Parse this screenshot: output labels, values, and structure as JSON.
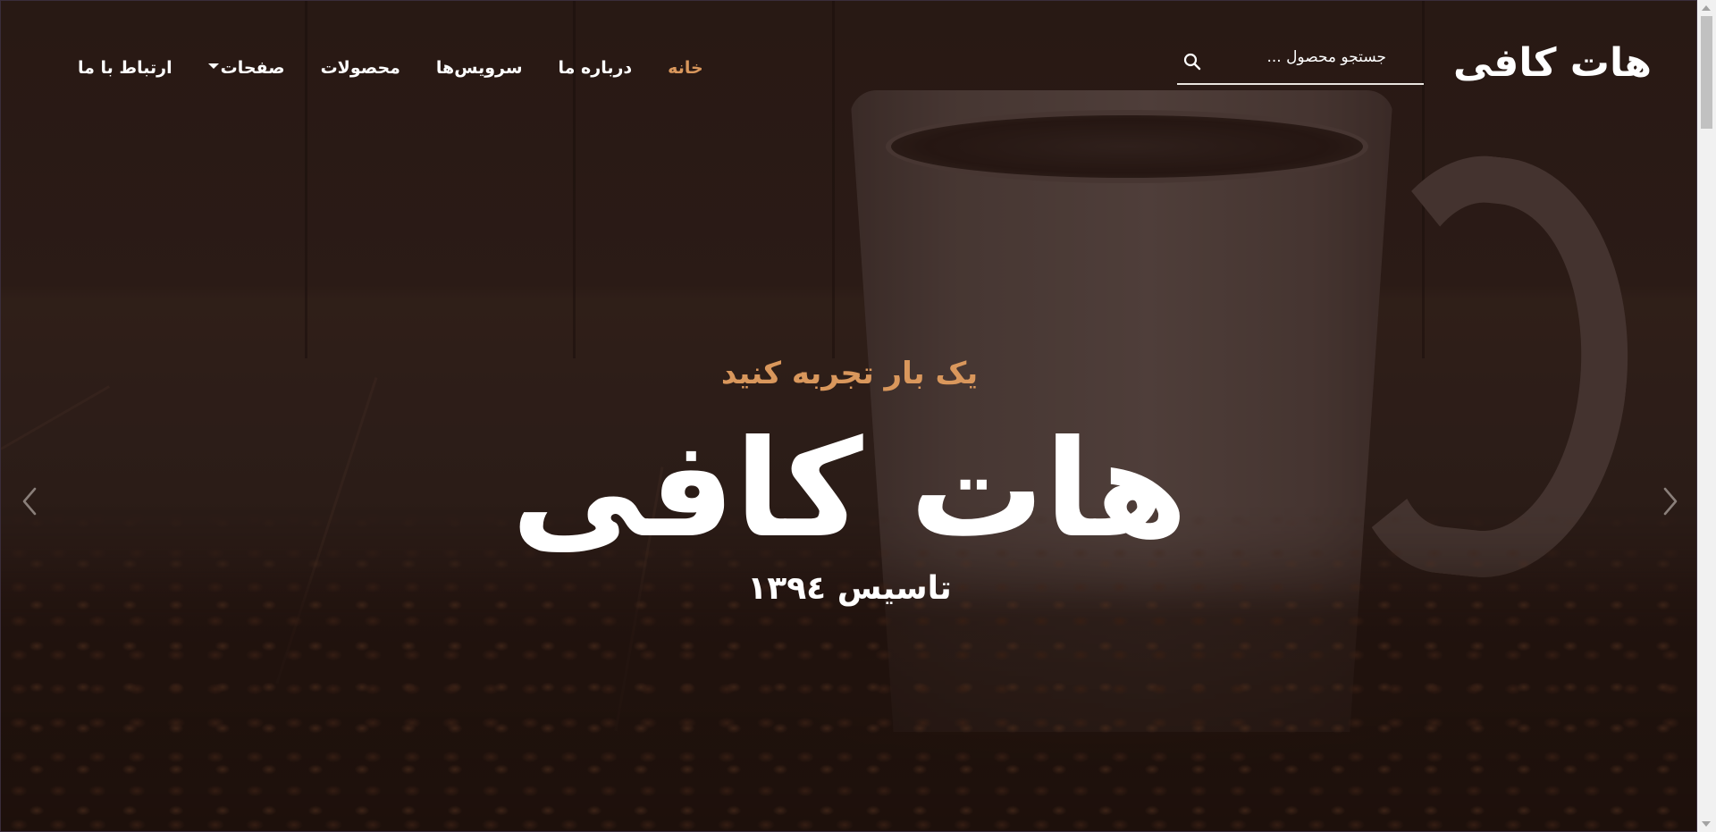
{
  "header": {
    "brand": "هات کافی",
    "search_placeholder": "جستجو محصول ...",
    "nav": [
      {
        "label": "خانه",
        "active": true
      },
      {
        "label": "درباره ما"
      },
      {
        "label": "سرویس‌ها"
      },
      {
        "label": "محصولات"
      },
      {
        "label": "صفحات",
        "has_dropdown": true
      },
      {
        "label": "ارتباط با ما"
      }
    ]
  },
  "hero": {
    "tagline": "یک بار تجربه کنید",
    "title": "هات کافی",
    "founded": "تاسیس ۱۳۹٤"
  },
  "icons": {
    "search": "search-icon",
    "prev": "chevron-left-icon",
    "next": "chevron-right-icon",
    "dropdown": "caret-down-icon"
  },
  "colors": {
    "accent": "#d9975c",
    "text": "#ffffff",
    "background": "#2a1b16"
  }
}
